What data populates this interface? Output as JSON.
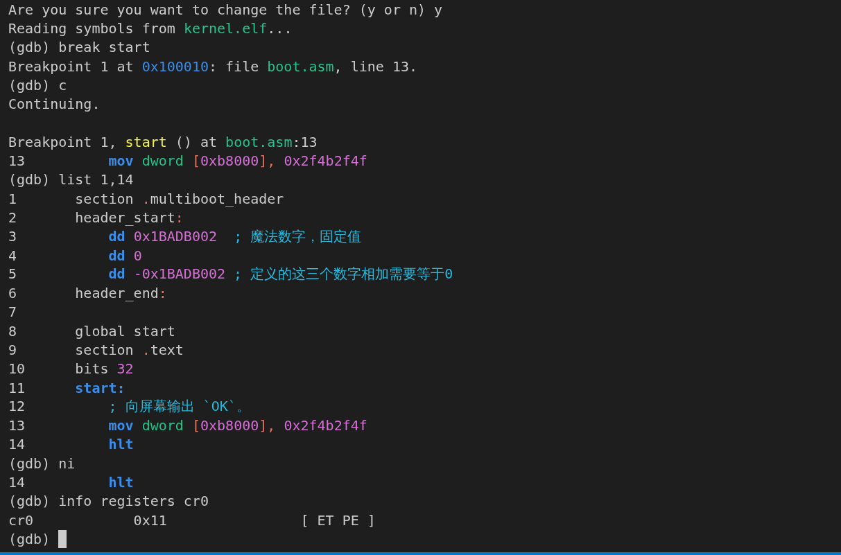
{
  "terminal": {
    "lines": [
      {
        "kind": "text",
        "segments": [
          {
            "text": "Are you sure you want to change the file? (y or n) y",
            "kind": "plain"
          }
        ]
      },
      {
        "kind": "text",
        "segments": [
          {
            "text": "Reading symbols from ",
            "kind": "plain"
          },
          {
            "text": "kernel.elf",
            "kind": "file"
          },
          {
            "text": "...",
            "kind": "plain"
          }
        ]
      },
      {
        "kind": "text",
        "segments": [
          {
            "text": "(gdb) break start",
            "kind": "plain"
          }
        ]
      },
      {
        "kind": "text",
        "segments": [
          {
            "text": "Breakpoint 1 at ",
            "kind": "plain"
          },
          {
            "text": "0x100010",
            "kind": "address"
          },
          {
            "text": ": file ",
            "kind": "plain"
          },
          {
            "text": "boot.asm",
            "kind": "file"
          },
          {
            "text": ", line 13.",
            "kind": "plain"
          }
        ]
      },
      {
        "kind": "text",
        "segments": [
          {
            "text": "(gdb) c",
            "kind": "plain"
          }
        ]
      },
      {
        "kind": "text",
        "segments": [
          {
            "text": "Continuing.",
            "kind": "plain"
          }
        ]
      },
      {
        "kind": "blank"
      },
      {
        "kind": "text",
        "segments": [
          {
            "text": "Breakpoint 1, ",
            "kind": "plain"
          },
          {
            "text": "start",
            "kind": "function"
          },
          {
            "text": " () at ",
            "kind": "plain"
          },
          {
            "text": "boot.asm",
            "kind": "file"
          },
          {
            "text": ":13",
            "kind": "plain"
          }
        ]
      },
      {
        "kind": "text",
        "segments": [
          {
            "text": "13          ",
            "kind": "plain"
          },
          {
            "text": "mov ",
            "kind": "keyword"
          },
          {
            "text": "dword ",
            "kind": "type"
          },
          {
            "text": "[",
            "kind": "punct"
          },
          {
            "text": "0xb8000",
            "kind": "number"
          },
          {
            "text": "], ",
            "kind": "punct"
          },
          {
            "text": "0x2f4b2f4f",
            "kind": "number"
          }
        ]
      },
      {
        "kind": "text",
        "segments": [
          {
            "text": "(gdb) list 1,14",
            "kind": "plain"
          }
        ]
      },
      {
        "kind": "text",
        "segments": [
          {
            "text": "1       section ",
            "kind": "plain"
          },
          {
            "text": ".",
            "kind": "punct"
          },
          {
            "text": "multiboot_header",
            "kind": "plain"
          }
        ]
      },
      {
        "kind": "text",
        "segments": [
          {
            "text": "2       header_start",
            "kind": "plain"
          },
          {
            "text": ":",
            "kind": "punct"
          }
        ]
      },
      {
        "kind": "text",
        "segments": [
          {
            "text": "3           ",
            "kind": "plain"
          },
          {
            "text": "dd ",
            "kind": "keyword"
          },
          {
            "text": "0x1BADB002",
            "kind": "number"
          },
          {
            "text": "  ; 魔法数字，固定值",
            "kind": "comment"
          }
        ]
      },
      {
        "kind": "text",
        "segments": [
          {
            "text": "4           ",
            "kind": "plain"
          },
          {
            "text": "dd ",
            "kind": "keyword"
          },
          {
            "text": "0",
            "kind": "number"
          }
        ]
      },
      {
        "kind": "text",
        "segments": [
          {
            "text": "5           ",
            "kind": "plain"
          },
          {
            "text": "dd ",
            "kind": "keyword"
          },
          {
            "text": "-0x1BADB002",
            "kind": "number"
          },
          {
            "text": " ; 定义的这三个数字相加需要等于0",
            "kind": "comment"
          }
        ]
      },
      {
        "kind": "text",
        "segments": [
          {
            "text": "6       header_end",
            "kind": "plain"
          },
          {
            "text": ":",
            "kind": "punct"
          }
        ]
      },
      {
        "kind": "text",
        "segments": [
          {
            "text": "7",
            "kind": "plain"
          }
        ]
      },
      {
        "kind": "text",
        "segments": [
          {
            "text": "8       global start",
            "kind": "plain"
          }
        ]
      },
      {
        "kind": "text",
        "segments": [
          {
            "text": "9       section ",
            "kind": "plain"
          },
          {
            "text": ".",
            "kind": "punct"
          },
          {
            "text": "text",
            "kind": "plain"
          }
        ]
      },
      {
        "kind": "text",
        "segments": [
          {
            "text": "10      bits ",
            "kind": "plain"
          },
          {
            "text": "32",
            "kind": "number"
          }
        ]
      },
      {
        "kind": "text",
        "segments": [
          {
            "text": "11      ",
            "kind": "plain"
          },
          {
            "text": "start:",
            "kind": "keyword"
          }
        ]
      },
      {
        "kind": "text",
        "segments": [
          {
            "text": "12          ",
            "kind": "plain"
          },
          {
            "text": "; 向屏幕输出 `OK`。",
            "kind": "comment"
          }
        ]
      },
      {
        "kind": "text",
        "segments": [
          {
            "text": "13          ",
            "kind": "plain"
          },
          {
            "text": "mov ",
            "kind": "keyword"
          },
          {
            "text": "dword ",
            "kind": "type"
          },
          {
            "text": "[",
            "kind": "punct"
          },
          {
            "text": "0xb8000",
            "kind": "number"
          },
          {
            "text": "], ",
            "kind": "punct"
          },
          {
            "text": "0x2f4b2f4f",
            "kind": "number"
          }
        ]
      },
      {
        "kind": "text",
        "segments": [
          {
            "text": "14          ",
            "kind": "plain"
          },
          {
            "text": "hlt",
            "kind": "keyword"
          }
        ]
      },
      {
        "kind": "text",
        "segments": [
          {
            "text": "(gdb) ni",
            "kind": "plain"
          }
        ]
      },
      {
        "kind": "text",
        "segments": [
          {
            "text": "14          ",
            "kind": "plain"
          },
          {
            "text": "hlt",
            "kind": "keyword"
          }
        ]
      },
      {
        "kind": "text",
        "segments": [
          {
            "text": "(gdb) info registers cr0",
            "kind": "plain"
          }
        ]
      },
      {
        "kind": "text",
        "segments": [
          {
            "text": "cr0            0x11                [ ET PE ]",
            "kind": "plain"
          }
        ]
      },
      {
        "kind": "text",
        "segments": [
          {
            "text": "(gdb) ",
            "kind": "plain"
          }
        ],
        "cursor": true
      }
    ]
  }
}
